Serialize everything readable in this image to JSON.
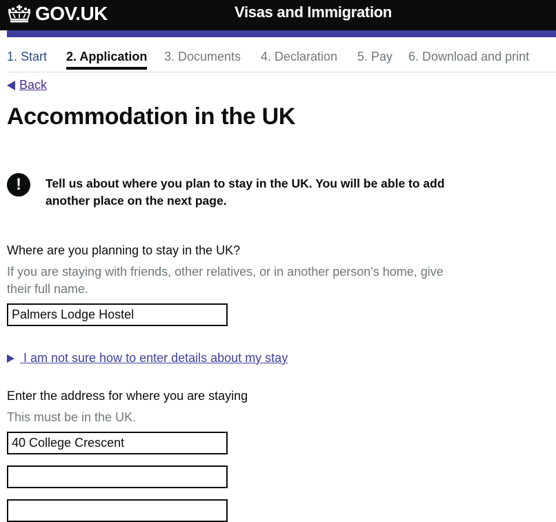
{
  "header": {
    "logo_text": "GOV.UK",
    "logo_icon": "crown-icon",
    "service_name": "Visas and Immigration"
  },
  "colors": {
    "header_bg": "#0b0c0c",
    "accent_bar": "#3f3fa0",
    "link": "#4c2c92",
    "hint_text": "#6f777b"
  },
  "steps": [
    {
      "label": "1. Start",
      "state": "done"
    },
    {
      "label": "2. Application",
      "state": "active"
    },
    {
      "label": "3. Documents",
      "state": "upcoming"
    },
    {
      "label": "4. Declaration",
      "state": "upcoming"
    },
    {
      "label": "5. Pay",
      "state": "upcoming"
    },
    {
      "label": "6. Download and print",
      "state": "upcoming"
    }
  ],
  "back_link": {
    "label": "Back",
    "icon": "triangle-left-icon"
  },
  "page_title": "Accommodation in the UK",
  "warning": {
    "icon": "exclamation-icon",
    "icon_glyph": "!",
    "text": "Tell us about where you plan to stay in the UK. You will be able to add another place on the next page."
  },
  "place_question": {
    "label": "Where are you planning to stay in the UK?",
    "hint": "If you are staying with friends, other relatives, or in another person's home, give their full name.",
    "value": "Palmers Lodge Hostel"
  },
  "details_toggle": {
    "label": " I am not sure how to enter details about my stay",
    "icon": "triangle-right-icon"
  },
  "address_question": {
    "label": "Enter the address for where you are staying",
    "hint": "This must be in the UK.",
    "lines": [
      "40 College Crescent",
      "",
      ""
    ]
  }
}
